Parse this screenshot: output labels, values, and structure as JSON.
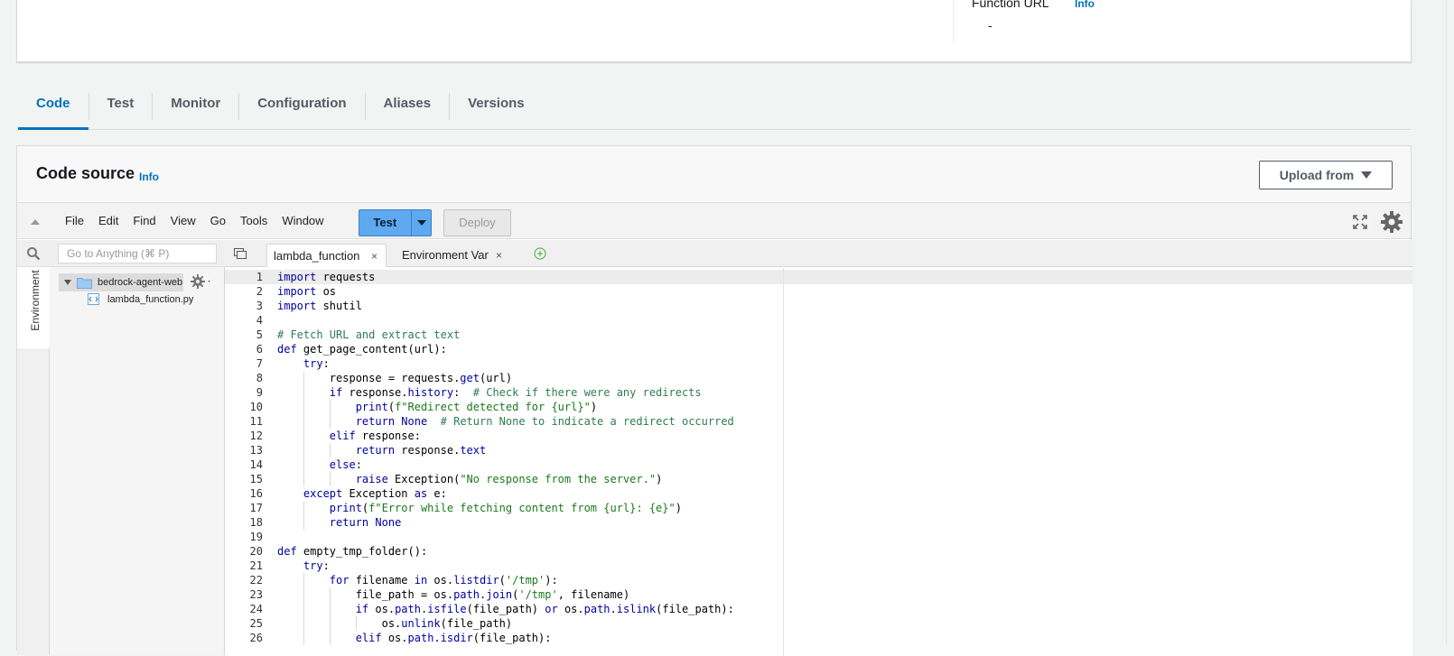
{
  "top_card": {
    "function_url_label": "Function URL",
    "function_url_info": "Info",
    "function_url_value": "-"
  },
  "tabs": [
    {
      "label": "Code",
      "active": true
    },
    {
      "label": "Test"
    },
    {
      "label": "Monitor"
    },
    {
      "label": "Configuration"
    },
    {
      "label": "Aliases"
    },
    {
      "label": "Versions"
    }
  ],
  "code_source": {
    "title": "Code source",
    "info": "Info",
    "upload_label": "Upload from"
  },
  "menubar": {
    "items": [
      "File",
      "Edit",
      "Find",
      "View",
      "Go",
      "Tools",
      "Window"
    ],
    "test_label": "Test",
    "deploy_label": "Deploy"
  },
  "sidebar": {
    "env_label": "Environment",
    "search_placeholder": "Go to Anything (⌘ P)",
    "root_folder": "bedrock-agent-web-",
    "file": "lambda_function.py"
  },
  "editor_tabs": {
    "active": "lambda_function",
    "inactive": "Environment Var",
    "close": "×"
  },
  "code_lines": [
    {
      "n": "1",
      "html": "<span class=\"kw\">import</span> requests"
    },
    {
      "n": "2",
      "html": "<span class=\"kw\">import</span> os"
    },
    {
      "n": "3",
      "html": "<span class=\"kw\">import</span> shutil"
    },
    {
      "n": "4",
      "html": ""
    },
    {
      "n": "5",
      "html": "<span class=\"cm\"># Fetch URL and extract text</span>"
    },
    {
      "n": "6",
      "html": "<span class=\"kw\">def</span> get_page_content(url):"
    },
    {
      "n": "7",
      "html": "    <span class=\"kw\">try</span>:"
    },
    {
      "n": "8",
      "html": "        response = requests.<span class=\"fn\">get</span>(url)"
    },
    {
      "n": "9",
      "html": "        <span class=\"kw\">if</span> response.<span class=\"fn\">history</span>:  <span class=\"cm\"># Check if there were any redirects</span>"
    },
    {
      "n": "10",
      "html": "            <span class=\"builtin\">print</span>(<span class=\"str\">f\"Redirect detected for {url}\"</span>)"
    },
    {
      "n": "11",
      "html": "            <span class=\"kw\">return</span> <span class=\"kw\">None</span>  <span class=\"cm\"># Return None to indicate a redirect occurred</span>"
    },
    {
      "n": "12",
      "html": "        <span class=\"kw\">elif</span> response:"
    },
    {
      "n": "13",
      "html": "            <span class=\"kw\">return</span> response.<span class=\"fn\">text</span>"
    },
    {
      "n": "14",
      "html": "        <span class=\"kw\">else</span>:"
    },
    {
      "n": "15",
      "html": "            <span class=\"kw\">raise</span> Exception(<span class=\"str\">\"No response from the server.\"</span>)"
    },
    {
      "n": "16",
      "html": "    <span class=\"kw\">except</span> Exception <span class=\"kw\">as</span> e:"
    },
    {
      "n": "17",
      "html": "        <span class=\"builtin\">print</span>(<span class=\"str\">f\"Error while fetching content from {url}: {e}\"</span>)"
    },
    {
      "n": "18",
      "html": "        <span class=\"kw\">return</span> <span class=\"kw\">None</span>"
    },
    {
      "n": "19",
      "html": ""
    },
    {
      "n": "20",
      "html": "<span class=\"kw\">def</span> empty_tmp_folder():"
    },
    {
      "n": "21",
      "html": "    <span class=\"kw\">try</span>:"
    },
    {
      "n": "22",
      "html": "        <span class=\"kw\">for</span> filename <span class=\"kw\">in</span> os.<span class=\"fn\">listdir</span>(<span class=\"str\">'/tmp'</span>):"
    },
    {
      "n": "23",
      "html": "            file_path = os.<span class=\"fn\">path</span>.<span class=\"fn\">join</span>(<span class=\"str\">'/tmp'</span>, filename)"
    },
    {
      "n": "24",
      "html": "            <span class=\"kw\">if</span> os.<span class=\"fn\">path</span>.<span class=\"fn\">isfile</span>(file_path) <span class=\"kw\">or</span> os.<span class=\"fn\">path</span>.<span class=\"fn\">islink</span>(file_path):"
    },
    {
      "n": "25",
      "html": "                os.<span class=\"fn\">unlink</span>(file_path)"
    },
    {
      "n": "26",
      "html": "            <span class=\"kw\">elif</span> os.<span class=\"fn\">path</span>.<span class=\"fn\">isdir</span>(file_path):"
    }
  ]
}
